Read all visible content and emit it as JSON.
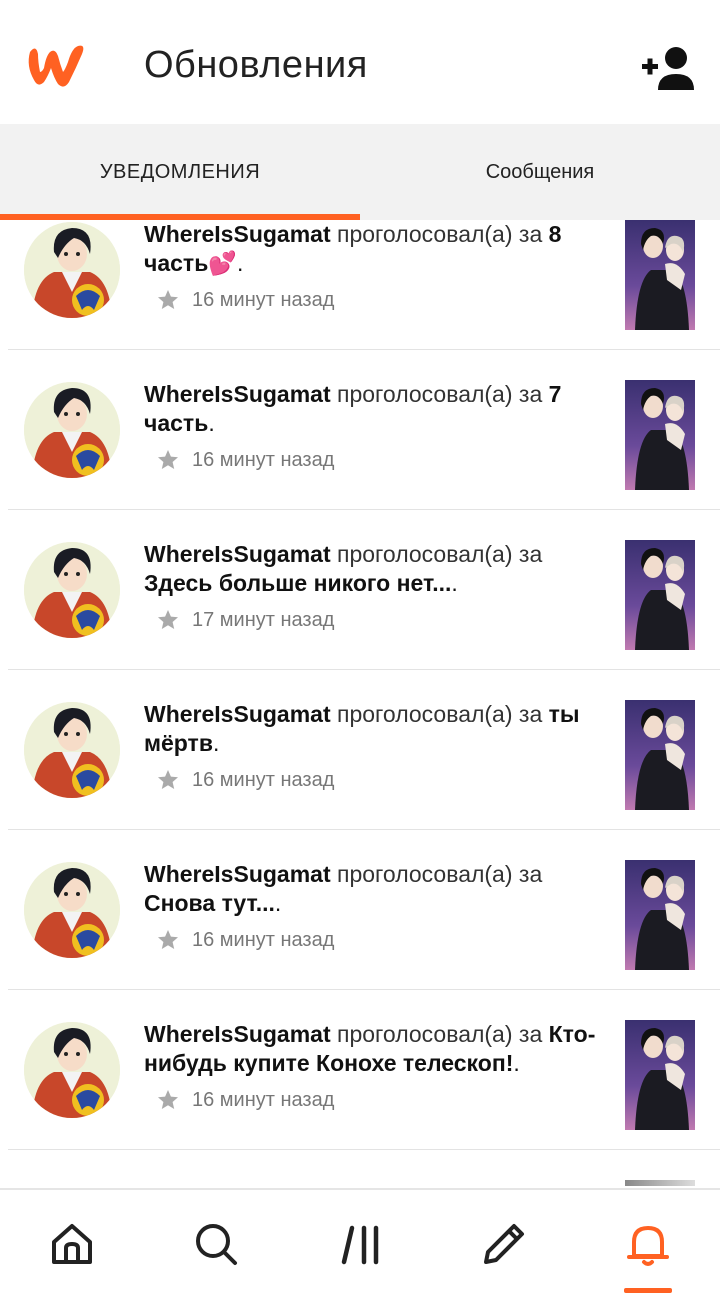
{
  "header": {
    "title": "Обновления",
    "brand_color": "#ff6122"
  },
  "tabs": [
    {
      "label": "УВЕДОМЛЕНИЯ",
      "active": true
    },
    {
      "label": "Сообщения",
      "active": false
    }
  ],
  "notifications": [
    {
      "user": "WhereIsSugamat",
      "verb": "проголосовал(а) за",
      "target": "8 часть💕",
      "suffix": ".",
      "time": "16 минут назад"
    },
    {
      "user": "WhereIsSugamat",
      "verb": "проголосовал(а) за",
      "target": "7 часть",
      "suffix": ".",
      "time": "16 минут назад"
    },
    {
      "user": "WhereIsSugamat",
      "verb": "проголосовал(а) за",
      "target": "Здесь больше никого нет...",
      "suffix": ".",
      "time": "17 минут назад"
    },
    {
      "user": "WhereIsSugamat",
      "verb": "проголосовал(а) за",
      "target": "ты мёртв",
      "suffix": ".",
      "time": "16 минут назад"
    },
    {
      "user": "WhereIsSugamat",
      "verb": "проголосовал(а) за",
      "target": "Снова тут...",
      "suffix": ".",
      "time": "16 минут назад"
    },
    {
      "user": "WhereIsSugamat",
      "verb": "проголосовал(а) за",
      "target": "Кто-нибудь купите Конохе телескоп!",
      "suffix": ".",
      "time": "16 минут назад"
    }
  ],
  "bottom_nav": [
    {
      "icon": "home-icon",
      "active": false
    },
    {
      "icon": "search-icon",
      "active": false
    },
    {
      "icon": "library-icon",
      "active": false
    },
    {
      "icon": "write-icon",
      "active": false
    },
    {
      "icon": "bell-icon",
      "active": true
    }
  ]
}
